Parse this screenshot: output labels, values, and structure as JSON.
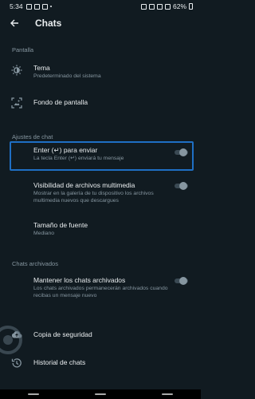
{
  "status_bar": {
    "time": "5:34",
    "battery": "62%"
  },
  "app_bar": {
    "title": "Chats"
  },
  "sections": {
    "display": "Pantalla",
    "chat_settings": "Ajustes de chat",
    "archived": "Chats archivados"
  },
  "items": {
    "theme": {
      "title": "Tema",
      "subtitle": "Predeterminado del sistema",
      "icon": "theme-icon"
    },
    "wallpaper": {
      "title": "Fondo de pantalla",
      "icon": "wallpaper-icon"
    },
    "enter_send": {
      "title": "Enter (↵) para enviar",
      "subtitle": "La tecla Enter (↵) enviará tu mensaje",
      "enabled": false
    },
    "media_visibility": {
      "title": "Visibilidad de archivos multimedia",
      "subtitle": "Mostrar en la galería de tu dispositivo los archivos multimedia nuevos que descargues",
      "enabled": false
    },
    "font_size": {
      "title": "Tamaño de fuente",
      "subtitle": "Mediano"
    },
    "keep_archived": {
      "title": "Mantener los chats archivados",
      "subtitle": "Los chats archivados permanecerán archivados cuando recibas un mensaje nuevo",
      "enabled": false
    },
    "backup": {
      "title": "Copia de seguridad",
      "icon": "cloud-upload-icon"
    },
    "history": {
      "title": "Historial de chats",
      "icon": "history-icon"
    }
  },
  "colors": {
    "background": "#111b21",
    "highlight": "#1f6fc4",
    "secondary_text": "#8696a0"
  }
}
